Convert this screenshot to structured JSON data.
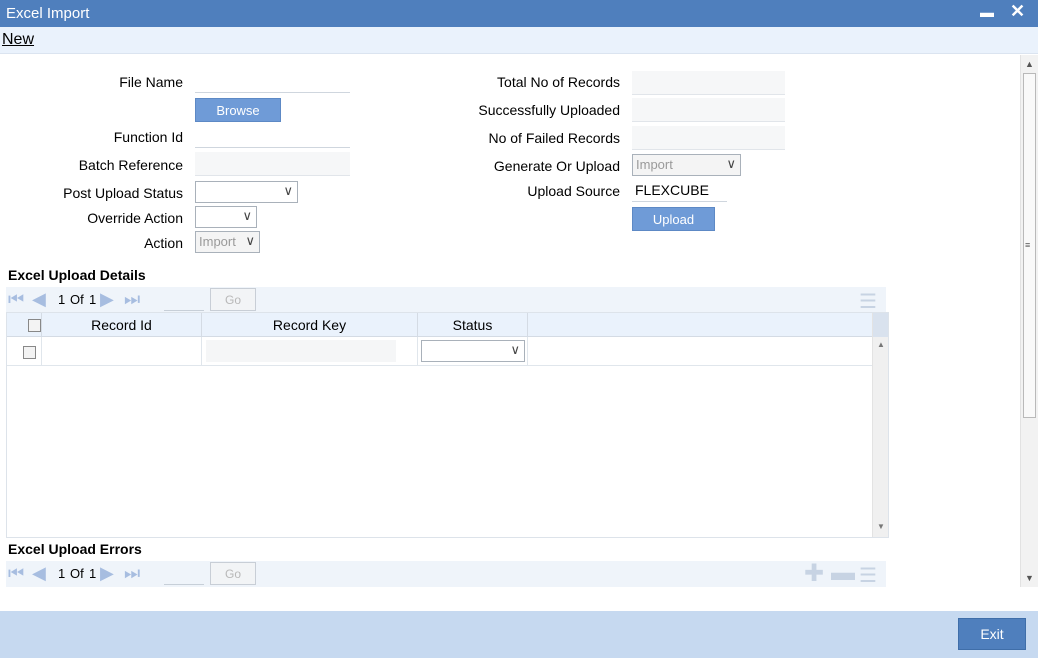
{
  "window": {
    "title": "Excel Import",
    "minimize_label": "▬",
    "close_label": "✕"
  },
  "menu": {
    "new_label": "New"
  },
  "form": {
    "file_name_label": "File Name",
    "browse_label": "Browse",
    "function_id_label": "Function Id",
    "batch_reference_label": "Batch Reference",
    "post_upload_status_label": "Post Upload Status",
    "override_action_label": "Override Action",
    "action_label": "Action",
    "action_value": "Import",
    "total_records_label": "Total No of Records",
    "successfully_uploaded_label": "Successfully Uploaded",
    "failed_records_label": "No of Failed Records",
    "generate_or_upload_label": "Generate Or Upload",
    "generate_or_upload_value": "Import",
    "upload_source_label": "Upload Source",
    "upload_source_value": "FLEXCUBE",
    "upload_label": "Upload"
  },
  "details": {
    "title": "Excel Upload Details",
    "pager": {
      "current": "1",
      "of_label": "Of",
      "total": "1",
      "go_label": "Go"
    },
    "columns": [
      "Record Id",
      "Record Key",
      "Status"
    ]
  },
  "errors": {
    "title": "Excel Upload Errors",
    "pager": {
      "current": "1",
      "of_label": "Of",
      "total": "1",
      "go_label": "Go"
    }
  },
  "footer": {
    "exit_label": "Exit"
  },
  "icons": {
    "first": "first-page-icon",
    "prev": "prev-page-icon",
    "next": "next-page-icon",
    "last": "last-page-icon",
    "list": "list-view-icon",
    "add": "add-row-icon",
    "remove": "remove-row-icon"
  },
  "colors": {
    "titlebar": "#4f7fbd",
    "button_blue": "#6f9bd7",
    "footer": "#c6d9f0",
    "header": "#eaf2fc"
  }
}
